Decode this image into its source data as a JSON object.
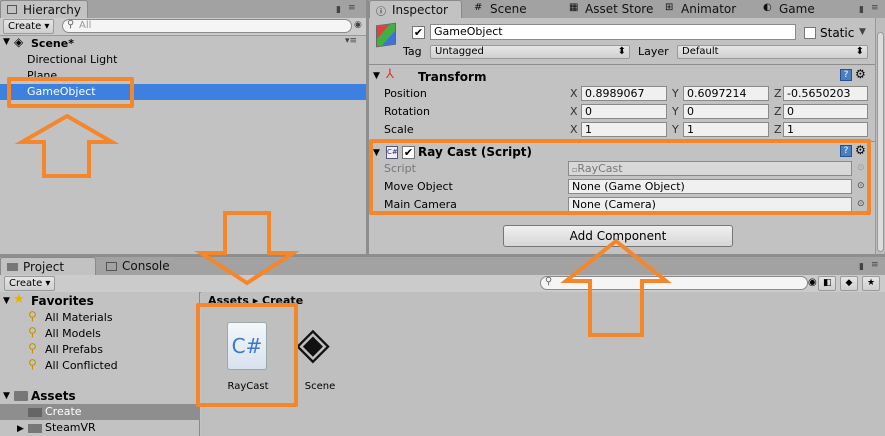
{
  "hierarchy": {
    "tab": "Hierarchy",
    "create": "Create",
    "search_placeholder": "All",
    "scene": "Scene*",
    "items": [
      "Directional Light",
      "Plane",
      "GameObject"
    ]
  },
  "tabs": [
    "Inspector",
    "Scene",
    "Asset Store",
    "Animator",
    "Game"
  ],
  "inspector": {
    "name": "GameObject",
    "static_label": "Static",
    "tag_label": "Tag",
    "tag_value": "Untagged",
    "layer_label": "Layer",
    "layer_value": "Default",
    "transform": {
      "title": "Transform",
      "rows": [
        {
          "label": "Position",
          "x": "0.8989067",
          "y": "0.6097214",
          "z": "-0.5650203"
        },
        {
          "label": "Rotation",
          "x": "0",
          "y": "0",
          "z": "0"
        },
        {
          "label": "Scale",
          "x": "1",
          "y": "1",
          "z": "1"
        }
      ]
    },
    "raycast": {
      "title": "Ray Cast (Script)",
      "rows": [
        {
          "label": "Script",
          "value": "RayCast"
        },
        {
          "label": "Move Object",
          "value": "None (Game Object)"
        },
        {
          "label": "Main Camera",
          "value": "None (Camera)"
        }
      ]
    },
    "add_component": "Add Component"
  },
  "axis": {
    "x": "X",
    "y": "Y",
    "z": "Z"
  },
  "project": {
    "tab": "Project",
    "console_tab": "Console",
    "create": "Create",
    "favorites": "Favorites",
    "favorite_items": [
      "All Materials",
      "All Models",
      "All Prefabs",
      "All Conflicted"
    ],
    "assets": "Assets",
    "asset_items": [
      "Create",
      "SteamVR"
    ],
    "breadcrumb": "Assets ▸ Create",
    "files": [
      "RayCast",
      "Scene"
    ]
  }
}
